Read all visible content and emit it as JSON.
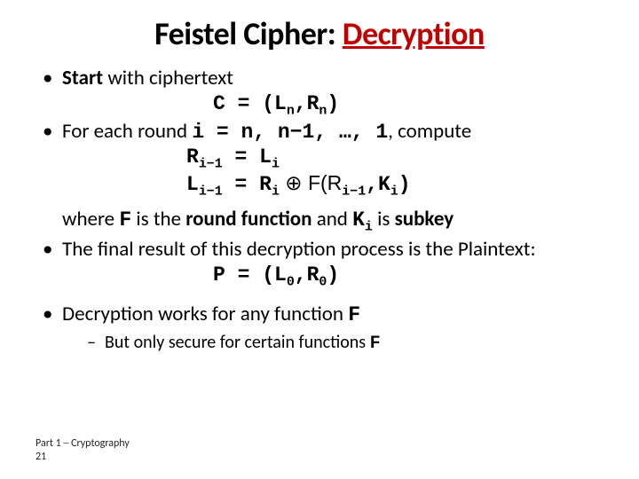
{
  "title": {
    "prefix": "Feistel Cipher: ",
    "emph": "Decryption"
  },
  "b1": {
    "lead": "Start",
    "rest": " with ciphertext",
    "formula": {
      "lhs": "C = (L",
      "s1": "n",
      "mid": ",R",
      "s2": "n",
      "rhs": ")"
    }
  },
  "b2": {
    "pre": "For each round ",
    "iter": "i = n, n−1, …, 1",
    "post": ", compute",
    "line1": {
      "a": "R",
      "as": "i−1",
      "eq": " = L",
      "bs": "i"
    },
    "line2": {
      "a": "L",
      "as": "i−1",
      "eq": " = R",
      "bs": "i",
      "op": " ⊕ F(R",
      "cs": "i−1",
      "mid": ",K",
      "ds": "i",
      "end": ")"
    }
  },
  "where": {
    "w": "where ",
    "f": "F",
    "mid": " is the ",
    "rf": "round function",
    "and": " and ",
    "k": "K",
    "ks": "i",
    "is": " is ",
    "sk": "subkey"
  },
  "b3": "The final result of this decryption process is the Plaintext:",
  "pform": {
    "lhs": "P = (L",
    "s1": "0",
    "mid": ",R",
    "s2": "0",
    "rhs": ")"
  },
  "b4": {
    "text": "Decryption works for any function ",
    "f": "F"
  },
  "b4s": {
    "text": "But only secure for certain functions ",
    "f": "F"
  },
  "footer": {
    "line": "Part 1 ─ Cryptography",
    "num": "21"
  }
}
